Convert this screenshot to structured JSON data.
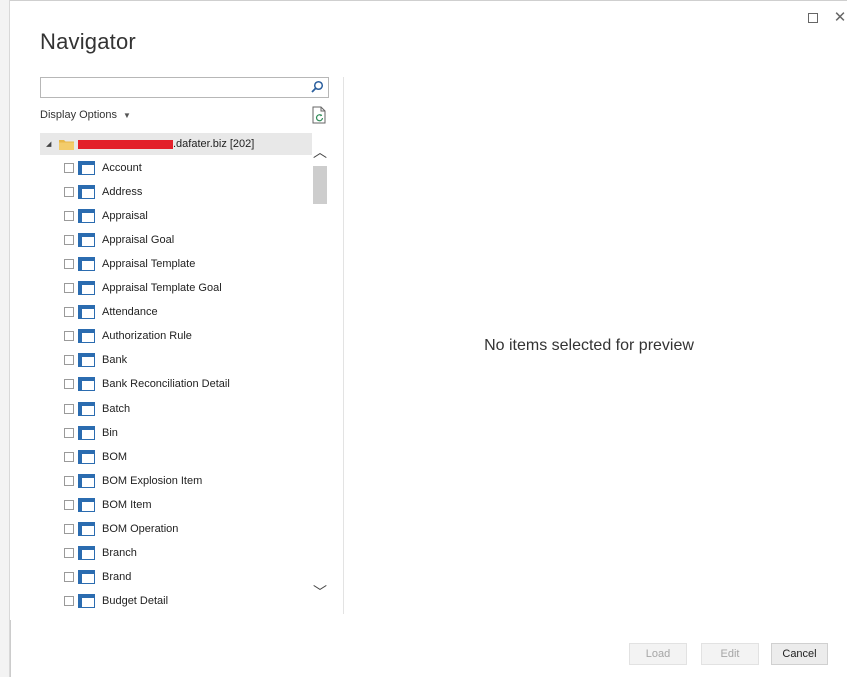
{
  "window": {
    "title": "Navigator",
    "maximize_glyph": "□",
    "close_glyph": "✕"
  },
  "search": {
    "value": "",
    "placeholder": "",
    "icon": "search-icon"
  },
  "display_options": {
    "label": "Display Options",
    "caret": "▼"
  },
  "tree": {
    "root": {
      "label": ".dafater.biz [202]",
      "expand_glyph": "◢",
      "icon": "folder-icon",
      "redacted": true
    },
    "items": [
      {
        "label": "Account",
        "checked": false
      },
      {
        "label": "Address",
        "checked": false
      },
      {
        "label": "Appraisal",
        "checked": false
      },
      {
        "label": "Appraisal Goal",
        "checked": false
      },
      {
        "label": "Appraisal Template",
        "checked": false
      },
      {
        "label": "Appraisal Template Goal",
        "checked": false
      },
      {
        "label": "Attendance",
        "checked": false
      },
      {
        "label": "Authorization Rule",
        "checked": false
      },
      {
        "label": "Bank",
        "checked": false
      },
      {
        "label": "Bank Reconciliation Detail",
        "checked": false
      },
      {
        "label": "Batch",
        "checked": false
      },
      {
        "label": "Bin",
        "checked": false
      },
      {
        "label": "BOM",
        "checked": false
      },
      {
        "label": "BOM Explosion Item",
        "checked": false
      },
      {
        "label": "BOM Item",
        "checked": false
      },
      {
        "label": "BOM Operation",
        "checked": false
      },
      {
        "label": "Branch",
        "checked": false
      },
      {
        "label": "Brand",
        "checked": false
      },
      {
        "label": "Budget Detail",
        "checked": false
      }
    ]
  },
  "scrollbar": {
    "up_glyph": "︿",
    "down_glyph": "﹀"
  },
  "preview": {
    "message": "No items selected for preview"
  },
  "buttons": {
    "load": "Load",
    "edit": "Edit",
    "cancel": "Cancel"
  },
  "colors": {
    "accent_icon": "#2b6cb0",
    "redaction": "#e3202a",
    "folder": "#e8b84a"
  }
}
